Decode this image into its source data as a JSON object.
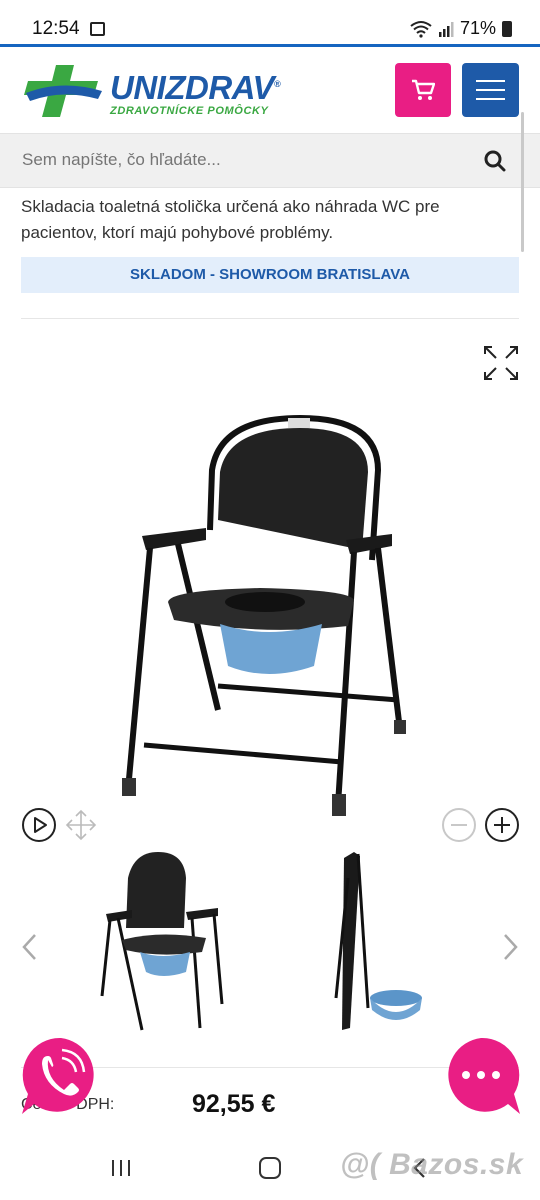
{
  "status_bar": {
    "time": "12:54",
    "battery": "71%"
  },
  "header": {
    "logo_title": "UNIZDRAV",
    "logo_reg": "®",
    "logo_subtitle": "ZDRAVOTNÍCKE POMÔCKY",
    "cart_icon": "cart-icon",
    "menu_icon": "hamburger-icon"
  },
  "search": {
    "placeholder": "Sem napíšte, čo hľadáte...",
    "icon": "search-icon"
  },
  "product": {
    "description": "Skladacia toaletná stolička určená ako náhrada WC pre pacientov, ktorí majú pohybové problémy.",
    "stock": "SKLADOM - SHOWROOM BRATISLAVA",
    "price_label": "Cena s DPH:",
    "price": "92,55 €"
  },
  "gallery": {
    "expand_icon": "expand-icon",
    "play_icon": "play-icon",
    "move_icon": "move-icon",
    "zoom_out_icon": "zoom-out-icon",
    "zoom_in_icon": "zoom-in-icon",
    "prev_icon": "chevron-left-icon",
    "next_icon": "chevron-right-icon",
    "thumbnail_count": 2
  },
  "floating": {
    "call_icon": "phone-icon",
    "chat_icon": "chat-dots-icon"
  },
  "colors": {
    "brand_blue": "#1e5aa8",
    "brand_pink": "#e91e84",
    "brand_green": "#3aa842",
    "stock_bg": "#e3eefb"
  },
  "watermark": "@( Bazos.sk"
}
